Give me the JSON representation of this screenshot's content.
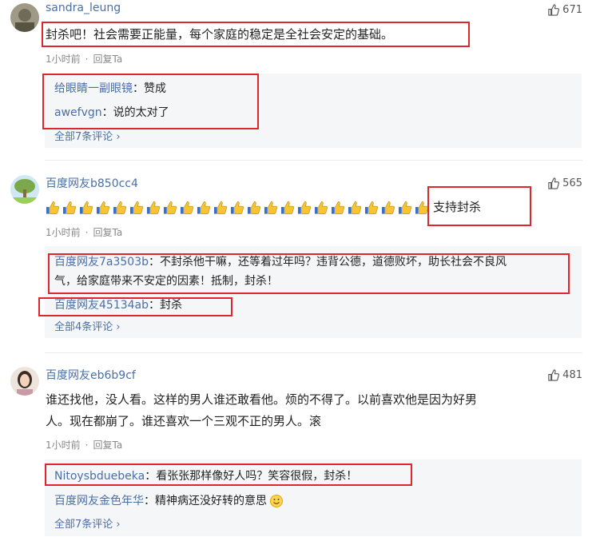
{
  "comments": [
    {
      "username": "sandra_leung",
      "likes": "671",
      "text": "封杀吧！社会需要正能量，每个家庭的稳定是全社会安定的基础。",
      "time": "1小时前",
      "reply_action": "回复Ta",
      "replies": [
        {
          "name": "给眼睛一副眼镜",
          "sep": "：",
          "text": "赞成"
        },
        {
          "name": "awefvgn",
          "sep": "：",
          "text": "说的太对了"
        }
      ],
      "all_link": "全部7条评论 ›"
    },
    {
      "username": "百度网友b850cc4",
      "likes": "565",
      "text": "支持封杀",
      "time": "1小时前",
      "reply_action": "回复Ta",
      "replies": [
        {
          "name": "百度网友7a3503b",
          "sep": "：",
          "text_line1": "不封杀他干嘛，还等着过年吗？违背公德，道德败坏，助长社会不良风",
          "text_line2": "气，给家庭带来不安定的因素！抵制，封杀！"
        },
        {
          "name": "百度网友45134ab",
          "sep": "：",
          "text": "封杀"
        }
      ],
      "all_link": "全部4条评论 ›"
    },
    {
      "username": "百度网友eb6b9cf",
      "likes": "481",
      "text_line1": "谁还找他，没人看。这样的男人谁还敢看他。烦的不得了。以前喜欢他是因为好男",
      "text_line2": "人。现在都崩了。谁还喜欢一个三观不正的男人。滚",
      "time": "1小时前",
      "reply_action": "回复Ta",
      "replies": [
        {
          "name": "Nitoysbduebeka",
          "sep": "：",
          "text": "看张张那样像好人吗？笑容很假，封杀！"
        },
        {
          "name": "百度网友金色年华",
          "sep": "：",
          "text": "精神病还没好转的意思"
        }
      ],
      "all_link": "全部7条评论 ›"
    }
  ],
  "colors": {
    "link": "#4a6fa5",
    "annotation": "#e0262d",
    "reply_bg": "#f5f6f8"
  }
}
